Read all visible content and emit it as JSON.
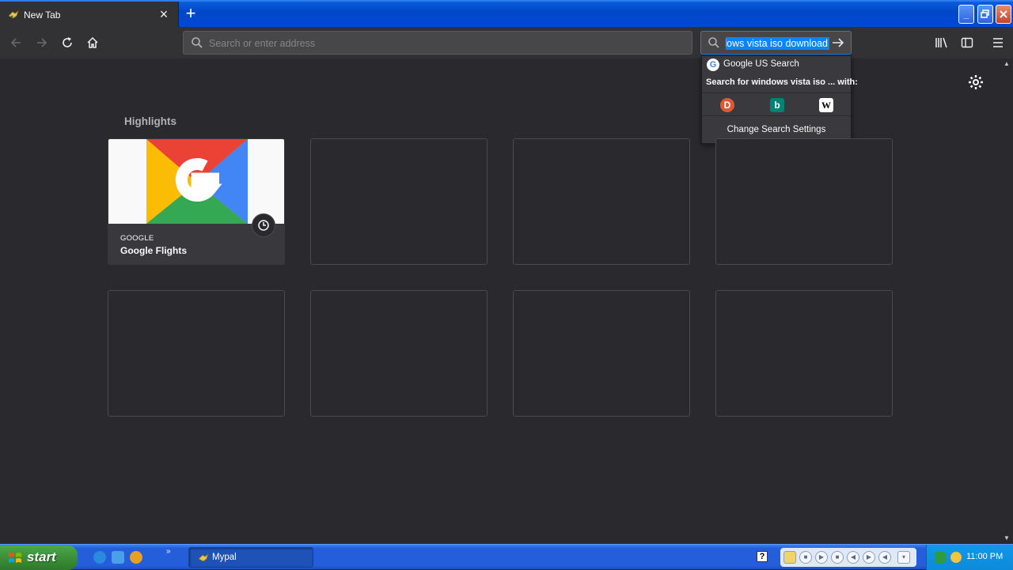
{
  "browser": {
    "tab_title": "New Tab",
    "close_tab": "×",
    "new_tab": "+"
  },
  "navbar": {
    "url_placeholder": "Search or enter address",
    "search_value": "windows vista iso download"
  },
  "search_popup": {
    "engine_name": "Google US Search",
    "search_with": "Search for windows vista iso ... with:",
    "change_settings": "Change Search Settings",
    "engines": [
      "duckduckgo-icon",
      "bing-icon",
      "wikipedia-icon"
    ]
  },
  "highlights": {
    "title": "Highlights",
    "cards": [
      {
        "host": "GOOGLE",
        "title": "Google Flights"
      }
    ]
  },
  "taskbar": {
    "start_label": "start",
    "task_label": "Mypal",
    "clock": "11:00 PM",
    "help": "?"
  },
  "colors": {
    "page_bg": "#2a2a2e",
    "toolbar_bg": "#323234",
    "accent": "#0a84ff",
    "xp_blue": "#245edb",
    "start_green": "#3b8f38"
  }
}
